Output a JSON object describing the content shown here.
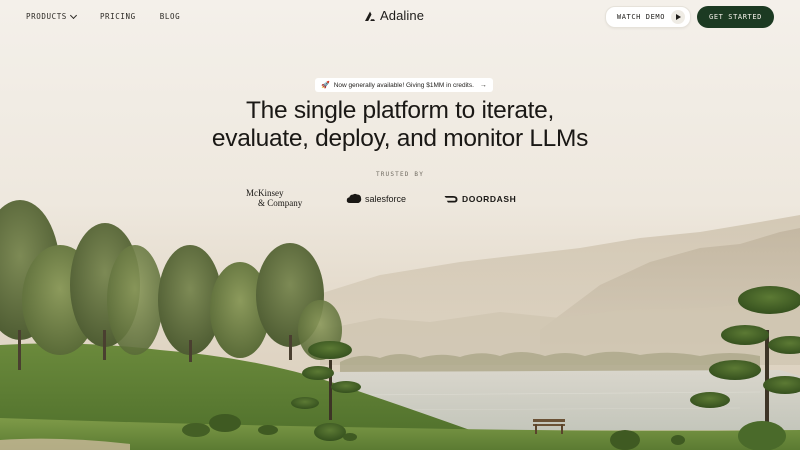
{
  "nav": {
    "products_label": "PRODUCTS",
    "pricing_label": "PRICING",
    "blog_label": "BLOG"
  },
  "brand": {
    "name": "Adaline"
  },
  "actions": {
    "watch_demo_label": "WATCH DEMO",
    "get_started_label": "GET STARTED"
  },
  "hero": {
    "announcement": "Now generally available! Giving $1MM in credits.",
    "headline_line1": "The single platform to iterate,",
    "headline_line2": "evaluate, deploy, and monitor LLMs",
    "trusted_label": "TRUSTED BY"
  },
  "customers": {
    "mckinsey_line1": "McKinsey",
    "mckinsey_line2": "& Company",
    "salesforce": "salesforce",
    "doordash": "DOORDASH"
  },
  "icons": {
    "announcement": "rocket-icon",
    "announcement_arrow": "arrow-right-icon",
    "products_menu": "chevron-down-icon",
    "watch_demo": "play-icon"
  },
  "colors": {
    "primary_button": "#1c3a22",
    "background": "#f3efe8"
  }
}
